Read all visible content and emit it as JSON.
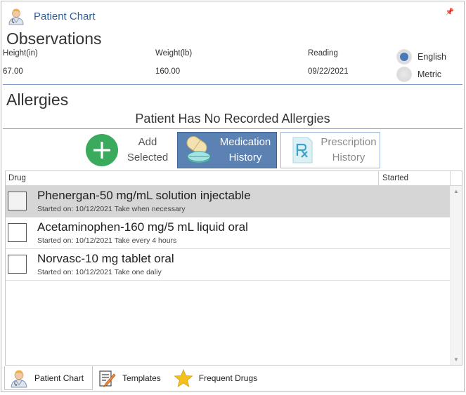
{
  "window": {
    "title": "Patient Chart",
    "pin_glyph": "📌"
  },
  "observations": {
    "title": "Observations",
    "height": {
      "label": "Height(in)",
      "value": "67.00"
    },
    "weight": {
      "label": "Weight(lb)",
      "value": "160.00"
    },
    "reading": {
      "label": "Reading",
      "value": "09/22/2021"
    },
    "units": [
      {
        "label": "English",
        "selected": true
      },
      {
        "label": "Metric",
        "selected": false
      }
    ]
  },
  "allergies": {
    "title": "Allergies",
    "message": "Patient Has No Recorded Allergies"
  },
  "actions": {
    "add_line1": "Add",
    "add_line2": "Selected",
    "med_line1": "Medication",
    "med_line2": "History",
    "rx_line1": "Prescription",
    "rx_line2": "History"
  },
  "grid": {
    "columns": {
      "drug": "Drug",
      "started": "Started"
    },
    "rows": [
      {
        "name": "Phenergan-50 mg/mL solution injectable",
        "detail": "Started on: 10/12/2021 Take when necessary",
        "selected": true
      },
      {
        "name": "Acetaminophen-160 mg/5 mL liquid oral",
        "detail": "Started on: 10/12/2021 Take every 4 hours",
        "selected": false
      },
      {
        "name": "Norvasc-10 mg tablet oral",
        "detail": "Started on: 10/12/2021 Take one daliy",
        "selected": false
      }
    ]
  },
  "tabs": [
    {
      "label": "Patient Chart",
      "icon": "doctor-icon",
      "active": true
    },
    {
      "label": "Templates",
      "icon": "clipboard-pencil-icon",
      "active": false
    },
    {
      "label": "Frequent Drugs",
      "icon": "star-icon",
      "active": false
    }
  ],
  "colors": {
    "title_blue": "#2e5f9a",
    "accent_blue": "#5b82b3",
    "add_green": "#3aaa5c",
    "selected_row": "#d6d6d6",
    "star_gold": "#f4c01e"
  }
}
